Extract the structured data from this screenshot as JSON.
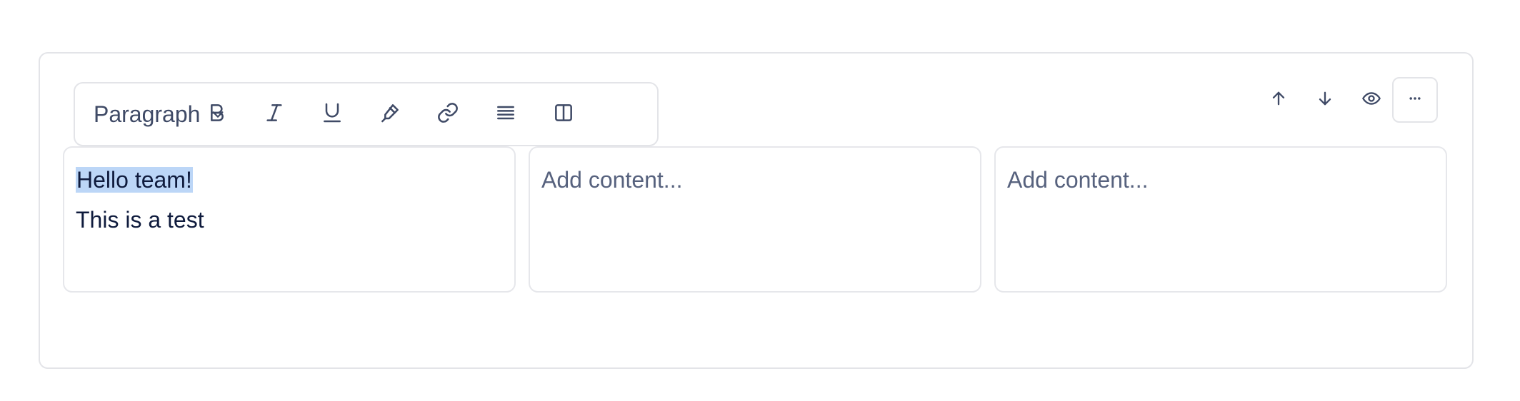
{
  "toolbar": {
    "block_type": "Paragraph",
    "icons": [
      "bold-icon",
      "italic-icon",
      "underline-icon",
      "highlighter-icon",
      "link-icon",
      "align-justify-icon",
      "columns-icon"
    ]
  },
  "block_actions": [
    "arrow-up-icon",
    "arrow-down-icon",
    "eye-icon",
    "more-icon"
  ],
  "columns": [
    {
      "lines": [
        "Hello team!",
        "This is a test"
      ],
      "selected_line": "Hello team!"
    },
    {
      "placeholder": "Add content..."
    },
    {
      "placeholder": "Add content..."
    }
  ],
  "colors": {
    "selection": "#bcd6f7",
    "border": "#e3e4e8",
    "text": "#0f1b3d",
    "muted": "#57627e"
  }
}
